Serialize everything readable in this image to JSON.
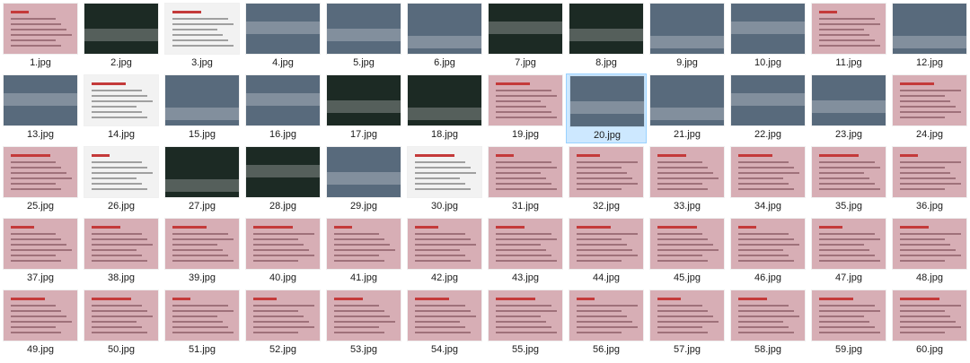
{
  "files": [
    {
      "name": "1.jpg",
      "kind": "slide"
    },
    {
      "name": "2.jpg",
      "kind": "dark"
    },
    {
      "name": "3.jpg",
      "kind": "light"
    },
    {
      "name": "4.jpg",
      "kind": "photo"
    },
    {
      "name": "5.jpg",
      "kind": "photo"
    },
    {
      "name": "6.jpg",
      "kind": "photo"
    },
    {
      "name": "7.jpg",
      "kind": "dark"
    },
    {
      "name": "8.jpg",
      "kind": "dark"
    },
    {
      "name": "9.jpg",
      "kind": "photo"
    },
    {
      "name": "10.jpg",
      "kind": "photo"
    },
    {
      "name": "11.jpg",
      "kind": "slide"
    },
    {
      "name": "12.jpg",
      "kind": "photo"
    },
    {
      "name": "13.jpg",
      "kind": "photo"
    },
    {
      "name": "14.jpg",
      "kind": "light"
    },
    {
      "name": "15.jpg",
      "kind": "photo"
    },
    {
      "name": "16.jpg",
      "kind": "photo"
    },
    {
      "name": "17.jpg",
      "kind": "dark"
    },
    {
      "name": "18.jpg",
      "kind": "dark"
    },
    {
      "name": "19.jpg",
      "kind": "slide"
    },
    {
      "name": "20.jpg",
      "kind": "photo",
      "selected": true
    },
    {
      "name": "21.jpg",
      "kind": "photo"
    },
    {
      "name": "22.jpg",
      "kind": "photo"
    },
    {
      "name": "23.jpg",
      "kind": "photo"
    },
    {
      "name": "24.jpg",
      "kind": "slide"
    },
    {
      "name": "25.jpg",
      "kind": "slide"
    },
    {
      "name": "26.jpg",
      "kind": "light"
    },
    {
      "name": "27.jpg",
      "kind": "dark"
    },
    {
      "name": "28.jpg",
      "kind": "dark"
    },
    {
      "name": "29.jpg",
      "kind": "photo"
    },
    {
      "name": "30.jpg",
      "kind": "light"
    },
    {
      "name": "31.jpg",
      "kind": "slide"
    },
    {
      "name": "32.jpg",
      "kind": "slide"
    },
    {
      "name": "33.jpg",
      "kind": "slide"
    },
    {
      "name": "34.jpg",
      "kind": "slide"
    },
    {
      "name": "35.jpg",
      "kind": "slide"
    },
    {
      "name": "36.jpg",
      "kind": "slide"
    },
    {
      "name": "37.jpg",
      "kind": "slide"
    },
    {
      "name": "38.jpg",
      "kind": "slide"
    },
    {
      "name": "39.jpg",
      "kind": "slide"
    },
    {
      "name": "40.jpg",
      "kind": "slide"
    },
    {
      "name": "41.jpg",
      "kind": "slide"
    },
    {
      "name": "42.jpg",
      "kind": "slide"
    },
    {
      "name": "43.jpg",
      "kind": "slide"
    },
    {
      "name": "44.jpg",
      "kind": "slide"
    },
    {
      "name": "45.jpg",
      "kind": "slide"
    },
    {
      "name": "46.jpg",
      "kind": "slide"
    },
    {
      "name": "47.jpg",
      "kind": "slide"
    },
    {
      "name": "48.jpg",
      "kind": "slide"
    },
    {
      "name": "49.jpg",
      "kind": "slide"
    },
    {
      "name": "50.jpg",
      "kind": "slide"
    },
    {
      "name": "51.jpg",
      "kind": "slide"
    },
    {
      "name": "52.jpg",
      "kind": "slide"
    },
    {
      "name": "53.jpg",
      "kind": "slide"
    },
    {
      "name": "54.jpg",
      "kind": "slide"
    },
    {
      "name": "55.jpg",
      "kind": "slide"
    },
    {
      "name": "56.jpg",
      "kind": "slide"
    },
    {
      "name": "57.jpg",
      "kind": "slide"
    },
    {
      "name": "58.jpg",
      "kind": "slide"
    },
    {
      "name": "59.jpg",
      "kind": "slide"
    },
    {
      "name": "60.jpg",
      "kind": "slide"
    }
  ],
  "colors": {
    "selection_bg": "#cde8ff",
    "selection_border": "#99d1ff",
    "slide_bg": "#d7aeb5"
  }
}
